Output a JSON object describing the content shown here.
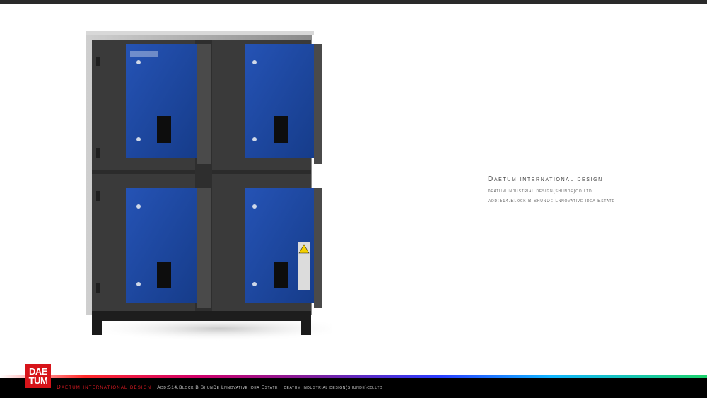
{
  "header": {},
  "info": {
    "title": "Daetum international design",
    "line2": "deatum industrial design(shunde)co.ltd",
    "line3": "Add:514.Block B ShunDe Lnnovative idea Estate"
  },
  "footer": {
    "logo_top": "DAE",
    "logo_bottom": "TUM",
    "brand": "Daetum international design",
    "address": "Add:514.Block B ShunDe Lnnovative idea Estate",
    "company": "deatum industrial design(shunde)co.ltd"
  },
  "colors": {
    "cabinet": "#3c3c3c",
    "panel_blue": "#1f4aa8",
    "accent_red": "#d7141a"
  },
  "icons": [
    "warning-label-icon",
    "brand-logo-icon"
  ]
}
